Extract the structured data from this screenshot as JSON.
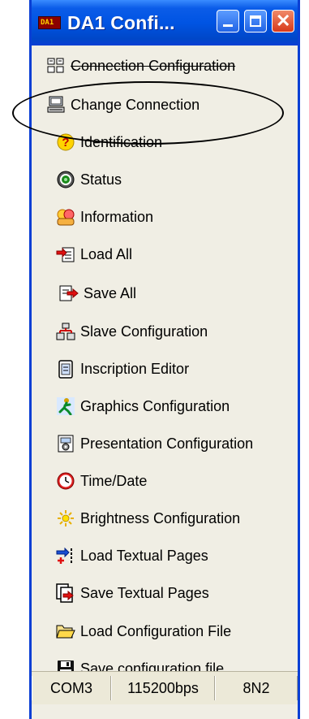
{
  "window": {
    "title": "DA1 Confi...",
    "app_icon_text": "DA1",
    "close_glyph": "✕"
  },
  "menu": {
    "items": [
      {
        "label": "Connection Configuration",
        "icon": "network-config-icon"
      },
      {
        "label": "Change Connection",
        "icon": "computer-icon"
      },
      {
        "label": "Identification",
        "icon": "question-icon"
      },
      {
        "label": "Status",
        "icon": "status-icon"
      },
      {
        "label": "Information",
        "icon": "information-icon"
      },
      {
        "label": "Load All",
        "icon": "load-all-icon"
      },
      {
        "label": "Save All",
        "icon": "save-all-icon"
      },
      {
        "label": "Slave Configuration",
        "icon": "slave-config-icon"
      },
      {
        "label": "Inscription Editor",
        "icon": "notepad-icon"
      },
      {
        "label": "Graphics Configuration",
        "icon": "graphics-icon"
      },
      {
        "label": "Presentation Configuration",
        "icon": "presentation-icon"
      },
      {
        "label": "Time/Date",
        "icon": "clock-icon"
      },
      {
        "label": "Brightness Configuration",
        "icon": "sun-icon"
      },
      {
        "label": "Load Textual Pages",
        "icon": "load-text-icon"
      },
      {
        "label": "Save Textual Pages",
        "icon": "save-text-icon"
      },
      {
        "label": "Load Configuration File",
        "icon": "folder-open-icon"
      },
      {
        "label": "Save configuration file",
        "icon": "floppy-disk-icon"
      }
    ]
  },
  "statusbar": {
    "port": "COM3",
    "baud": "115200bps",
    "format": "8N2"
  }
}
